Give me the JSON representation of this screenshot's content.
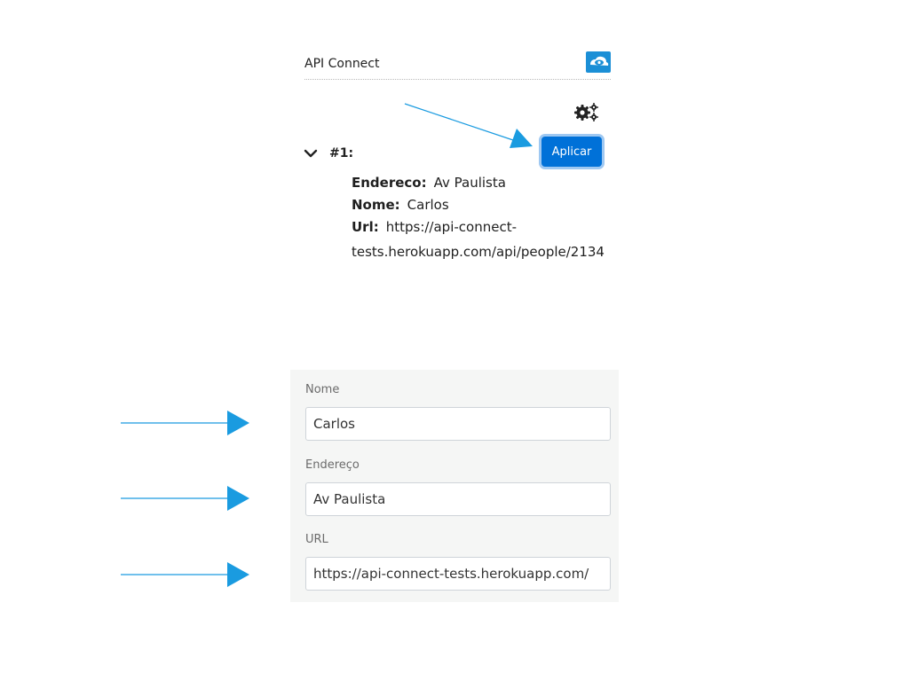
{
  "header": {
    "title": "API Connect",
    "logo_icon": "cloud-eye-logo",
    "settings_icon": "gears-icon",
    "apply_label": "Aplicar"
  },
  "record": {
    "label": "#1:",
    "toggle_icon": "chevron-down-icon",
    "fields": {
      "endereco_label": "Endereco:",
      "endereco_value": "Av Paulista",
      "nome_label": "Nome:",
      "nome_value": "Carlos",
      "url_label": "Url:",
      "url_value_line1": "https://api-connect-",
      "url_value_line2": "tests.herokuapp.com/api/people/2134"
    }
  },
  "form": {
    "nome_label": "Nome",
    "nome_value": "Carlos",
    "endereco_label": "Endereço",
    "endereco_value": "Av Paulista",
    "url_label": "URL",
    "url_value": "https://api-connect-tests.herokuapp.com/"
  },
  "colors": {
    "accent": "#0071d8",
    "arrow": "#1a9be0",
    "panel_bg": "#f5f6f5"
  }
}
